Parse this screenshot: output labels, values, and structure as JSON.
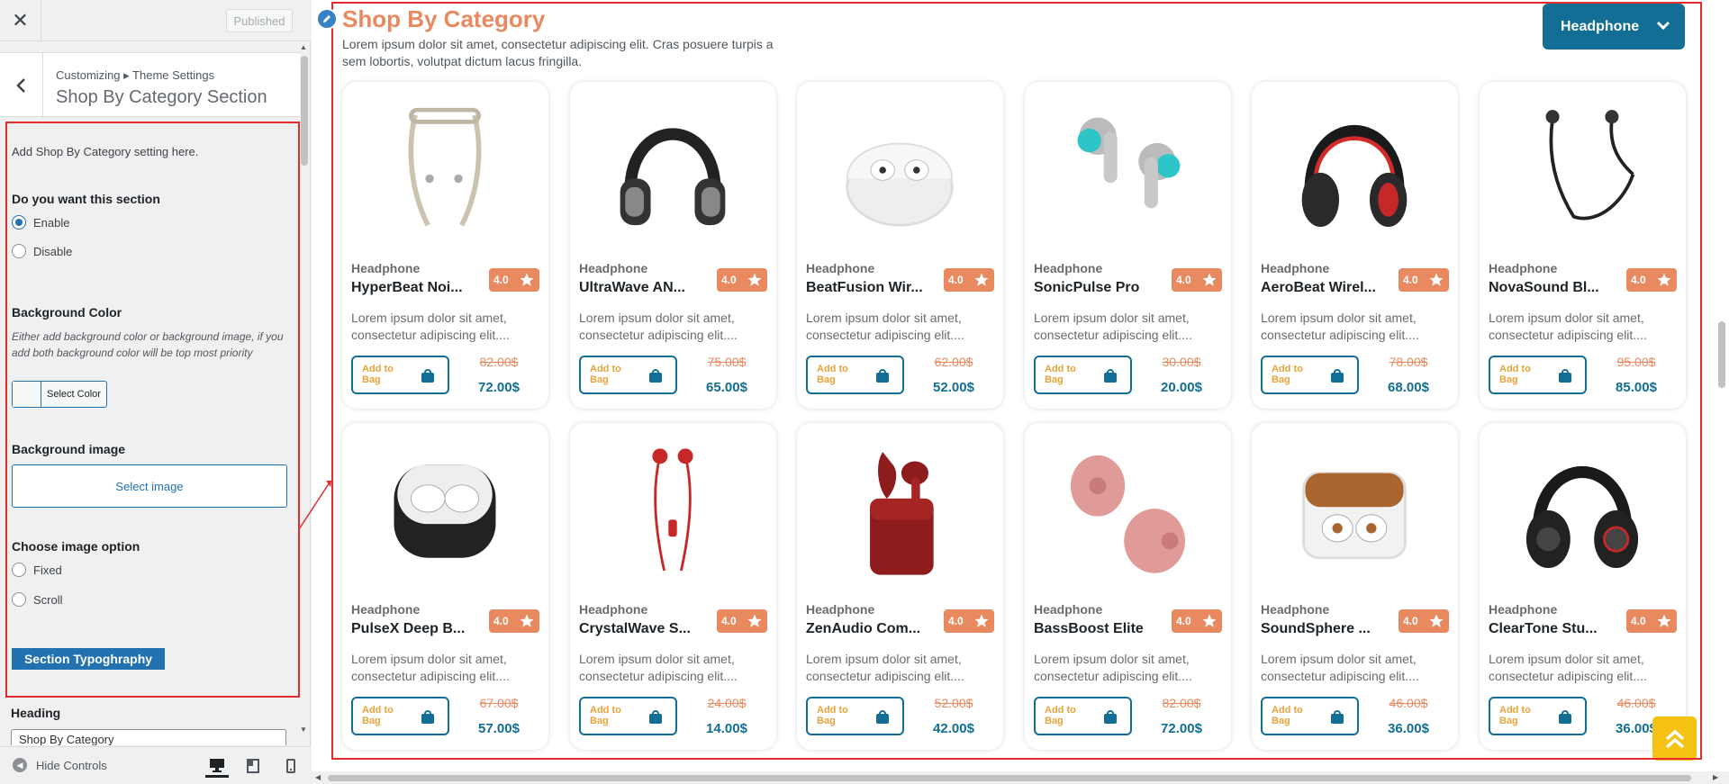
{
  "sidebar": {
    "close_icon": "close-icon",
    "published_label": "Published",
    "breadcrumb": "Customizing ▸ Theme Settings",
    "section_title": "Shop By Category Section",
    "description": "Add Shop By Category setting here.",
    "section_toggle": {
      "label": "Do you want this section",
      "options": [
        "Enable",
        "Disable"
      ],
      "selected": "Enable"
    },
    "background_color": {
      "label": "Background Color",
      "help": "Either add background color or background image, if you add both background color will be top most priority",
      "button": "Select Color"
    },
    "background_image": {
      "label": "Background image",
      "button": "Select image"
    },
    "image_option": {
      "label": "Choose image option",
      "options": [
        "Fixed",
        "Scroll"
      ]
    },
    "typography_button": "Section Typoghraphy",
    "heading": {
      "label": "Heading",
      "value": "Shop By Category"
    },
    "footer": {
      "hide_controls": "Hide Controls",
      "devices": [
        "desktop-icon",
        "tablet-icon",
        "mobile-icon"
      ],
      "active_device": "desktop-icon"
    }
  },
  "preview": {
    "title": "Shop By Category",
    "description": "Lorem ipsum dolor sit amet, consectetur adipiscing elit. Cras posuere turpis a sem lobortis, volutpat dictum lacus fringilla.",
    "dropdown_label": "Headphone",
    "add_to_bag": "Add to Bag",
    "products": [
      {
        "category": "Headphone",
        "name": "HyperBeat Noi...",
        "rating": "4.0",
        "desc": "Lorem ipsum dolor sit amet, consectetur adipiscing elit....",
        "old_price": "82.00$",
        "price": "72.00$"
      },
      {
        "category": "Headphone",
        "name": "UltraWave AN...",
        "rating": "4.0",
        "desc": "Lorem ipsum dolor sit amet, consectetur adipiscing elit....",
        "old_price": "75.00$",
        "price": "65.00$"
      },
      {
        "category": "Headphone",
        "name": "BeatFusion Wir...",
        "rating": "4.0",
        "desc": "Lorem ipsum dolor sit amet, consectetur adipiscing elit....",
        "old_price": "62.00$",
        "price": "52.00$"
      },
      {
        "category": "Headphone",
        "name": "SonicPulse Pro",
        "rating": "4.0",
        "desc": "Lorem ipsum dolor sit amet, consectetur adipiscing elit....",
        "old_price": "30.00$",
        "price": "20.00$"
      },
      {
        "category": "Headphone",
        "name": "AeroBeat Wirel...",
        "rating": "4.0",
        "desc": "Lorem ipsum dolor sit amet, consectetur adipiscing elit....",
        "old_price": "78.00$",
        "price": "68.00$"
      },
      {
        "category": "Headphone",
        "name": "NovaSound Bl...",
        "rating": "4.0",
        "desc": "Lorem ipsum dolor sit amet, consectetur adipiscing elit....",
        "old_price": "95.00$",
        "price": "85.00$"
      },
      {
        "category": "Headphone",
        "name": "PulseX Deep B...",
        "rating": "4.0",
        "desc": "Lorem ipsum dolor sit amet, consectetur adipiscing elit....",
        "old_price": "67.00$",
        "price": "57.00$"
      },
      {
        "category": "Headphone",
        "name": "CrystalWave S...",
        "rating": "4.0",
        "desc": "Lorem ipsum dolor sit amet, consectetur adipiscing elit....",
        "old_price": "24.00$",
        "price": "14.00$"
      },
      {
        "category": "Headphone",
        "name": "ZenAudio Com...",
        "rating": "4.0",
        "desc": "Lorem ipsum dolor sit amet, consectetur adipiscing elit....",
        "old_price": "52.00$",
        "price": "42.00$"
      },
      {
        "category": "Headphone",
        "name": "BassBoost Elite",
        "rating": "4.0",
        "desc": "Lorem ipsum dolor sit amet, consectetur adipiscing elit....",
        "old_price": "82.00$",
        "price": "72.00$"
      },
      {
        "category": "Headphone",
        "name": "SoundSphere ...",
        "rating": "4.0",
        "desc": "Lorem ipsum dolor sit amet, consectetur adipiscing elit....",
        "old_price": "46.00$",
        "price": "36.00$"
      },
      {
        "category": "Headphone",
        "name": "ClearTone Stu...",
        "rating": "4.0",
        "desc": "Lorem ipsum dolor sit amet, consectetur adipiscing elit....",
        "old_price": "46.00$",
        "price": "36.00$"
      }
    ]
  },
  "colors": {
    "accent": "#e8895f",
    "brand": "#126e94",
    "selection": "#e32c2c",
    "scroll_top": "#f5c214"
  }
}
